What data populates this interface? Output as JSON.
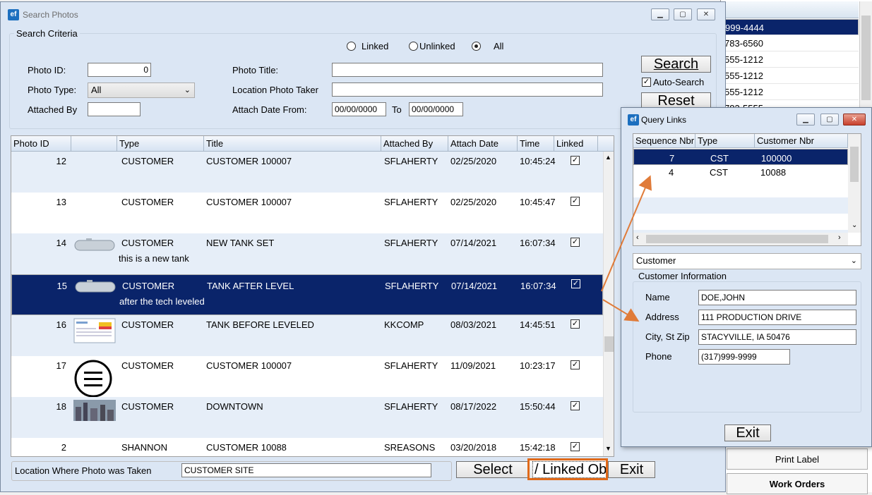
{
  "main_window": {
    "title": "Search Photos",
    "logo": "ef",
    "search_criteria_label": "Search Criteria",
    "filter": {
      "linked": "Linked",
      "unlinked": "Unlinked",
      "all": "All",
      "selected": "All"
    },
    "photo_id_label": "Photo ID:",
    "photo_id_value": "0",
    "photo_type_label": "Photo Type:",
    "photo_type_value": "All",
    "attached_by_label": "Attached By",
    "attached_by_value": "",
    "photo_title_label": "Photo Title:",
    "photo_title_value": "",
    "location_label": "Location Photo Taker",
    "location_value": "",
    "attach_date_from_label": "Attach Date From:",
    "attach_date_from": "00/00/0000",
    "to_label": "To",
    "attach_date_to": "00/00/0000",
    "search_button": "Search",
    "auto_search_label": "Auto-Search",
    "auto_search_checked": true,
    "reset_button": "Reset"
  },
  "grid": {
    "headers": [
      "Photo ID",
      "",
      "Type",
      "Title",
      "Attached By",
      "Attach Date",
      "Time",
      "Linked"
    ],
    "rows": [
      {
        "id": "12",
        "thumb": "none",
        "type": "CUSTOMER",
        "desc": "",
        "title": "CUSTOMER 100007",
        "by": "SFLAHERTY",
        "date": "02/25/2020",
        "time": "10:45:24",
        "linked": true
      },
      {
        "id": "13",
        "thumb": "none",
        "type": "CUSTOMER",
        "desc": "",
        "title": "CUSTOMER 100007",
        "by": "SFLAHERTY",
        "date": "02/25/2020",
        "time": "10:45:47",
        "linked": true
      },
      {
        "id": "14",
        "thumb": "tank",
        "type": "CUSTOMER",
        "desc": "this is a new tank",
        "title": "NEW TANK SET",
        "by": "SFLAHERTY",
        "date": "07/14/2021",
        "time": "16:07:34",
        "linked": true
      },
      {
        "id": "15",
        "thumb": "tank",
        "type": "CUSTOMER",
        "desc": "after the tech leveled",
        "title": "TANK AFTER LEVEL",
        "by": "SFLAHERTY",
        "date": "07/14/2021",
        "time": "16:07:34",
        "linked": true
      },
      {
        "id": "16",
        "thumb": "sheet",
        "type": "CUSTOMER",
        "desc": "",
        "title": "TANK BEFORE LEVELED",
        "by": "KKCOMP",
        "date": "08/03/2021",
        "time": "14:45:51",
        "linked": true
      },
      {
        "id": "17",
        "thumb": "menu",
        "type": "CUSTOMER",
        "desc": "",
        "title": "CUSTOMER 100007",
        "by": "SFLAHERTY",
        "date": "11/09/2021",
        "time": "10:23:17",
        "linked": true
      },
      {
        "id": "18",
        "thumb": "city",
        "type": "CUSTOMER",
        "desc": "",
        "title": "DOWNTOWN",
        "by": "SFLAHERTY",
        "date": "08/17/2022",
        "time": "15:50:44",
        "linked": true
      },
      {
        "id": "2",
        "thumb": "none",
        "type": "SHANNON",
        "desc": "",
        "title": "CUSTOMER 10088",
        "by": "SREASONS",
        "date": "03/20/2018",
        "time": "15:42:18",
        "linked": true
      }
    ],
    "selected_index": 3
  },
  "footer": {
    "location_label": "Location Where Photo was Taken",
    "location_value": "CUSTOMER SITE",
    "select_button": "Select",
    "linked_obj_button": "/ Linked Obj",
    "exit_button": "Exit"
  },
  "background_list": {
    "rows": [
      "999-4444",
      "783-6560",
      "555-1212",
      "555-1212",
      "555-1212",
      "783-5555"
    ],
    "selected_index": 0,
    "print_label_button": "Print Label",
    "work_orders_button": "Work Orders"
  },
  "query_links": {
    "title": "Query Links",
    "logo": "ef",
    "headers": [
      "Sequence Nbr",
      "Type",
      "Customer Nbr"
    ],
    "rows": [
      {
        "seq": "7",
        "type": "CST",
        "cust": "100000"
      },
      {
        "seq": "4",
        "type": "CST",
        "cust": "10088"
      }
    ],
    "selected_index": 0,
    "object_type": "Customer",
    "info_label": "Customer Information",
    "name_label": "Name",
    "name_value": "DOE,JOHN",
    "address_label": "Address",
    "address_value": "111 PRODUCTION DRIVE",
    "city_label": "City, St Zip",
    "city_value": "STACYVILLE, IA 50476",
    "phone_label": "Phone",
    "phone_value": "(317)999-9999",
    "exit_button": "Exit"
  },
  "colors": {
    "selection": "#0a246a",
    "window_bg": "#dbe6f4",
    "highlight_border": "#e06a1a",
    "arrow": "#e07b39"
  }
}
